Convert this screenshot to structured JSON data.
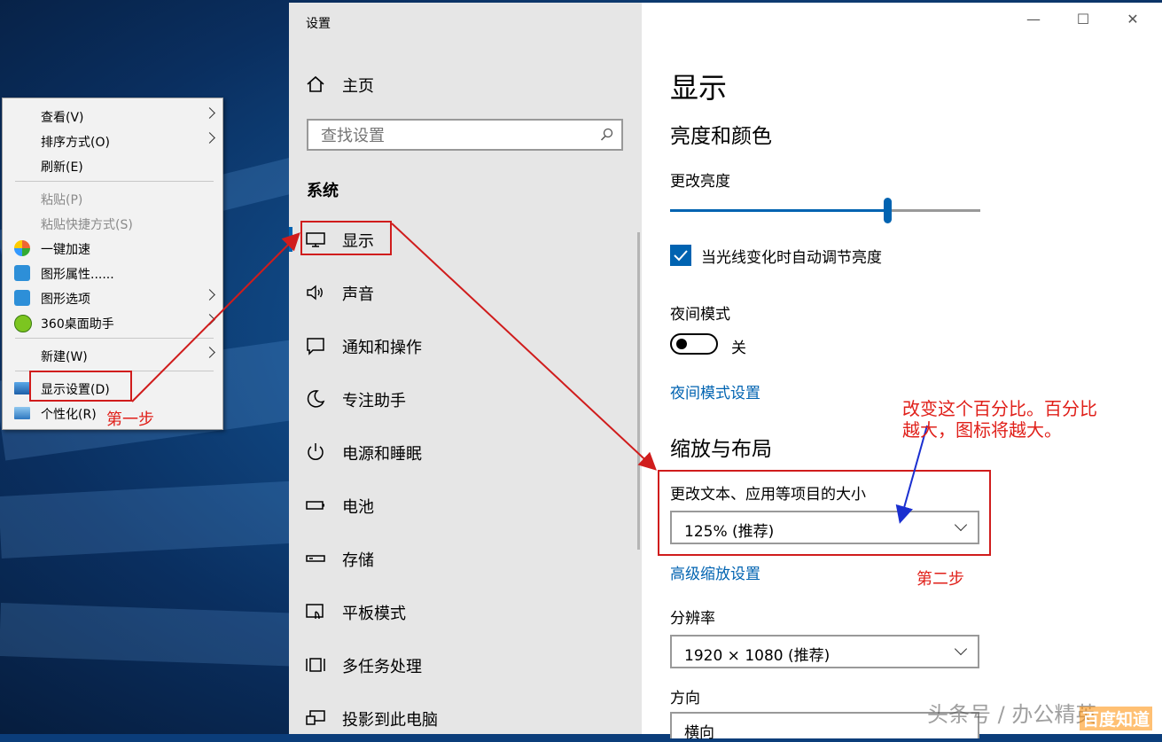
{
  "context_menu": {
    "items": [
      {
        "label": "查看(V)",
        "submenu": true
      },
      {
        "label": "排序方式(O)",
        "submenu": true
      },
      {
        "label": "刷新(E)"
      },
      {
        "label": "粘贴(P)",
        "disabled": true
      },
      {
        "label": "粘贴快捷方式(S)",
        "disabled": true
      },
      {
        "label": "一键加速",
        "icon": "speedup-icon"
      },
      {
        "label": "图形属性......",
        "icon": "graphics-properties-icon"
      },
      {
        "label": "图形选项",
        "icon": "graphics-options-icon",
        "submenu": true
      },
      {
        "label": "360桌面助手",
        "icon": "360-desktop-icon",
        "submenu": true
      },
      {
        "label": "新建(W)",
        "submenu": true
      },
      {
        "label": "显示设置(D)",
        "icon": "display-settings-icon"
      },
      {
        "label": "个性化(R)",
        "icon": "personalize-icon"
      }
    ]
  },
  "window": {
    "title": "设置",
    "controls": {
      "minimize": "—",
      "maximize": "☐",
      "close": "✕"
    }
  },
  "sidebar": {
    "home": "主页",
    "search_placeholder": "查找设置",
    "section": "系统",
    "items": [
      {
        "label": "显示",
        "icon": "monitor-icon",
        "selected": true
      },
      {
        "label": "声音",
        "icon": "speaker-icon"
      },
      {
        "label": "通知和操作",
        "icon": "notification-icon"
      },
      {
        "label": "专注助手",
        "icon": "moon-icon"
      },
      {
        "label": "电源和睡眠",
        "icon": "power-icon"
      },
      {
        "label": "电池",
        "icon": "battery-icon"
      },
      {
        "label": "存储",
        "icon": "storage-icon"
      },
      {
        "label": "平板模式",
        "icon": "tablet-mode-icon"
      },
      {
        "label": "多任务处理",
        "icon": "multitask-icon"
      },
      {
        "label": "投影到此电脑",
        "icon": "project-icon"
      }
    ]
  },
  "content": {
    "title": "显示",
    "brightness_heading": "亮度和颜色",
    "brightness_label": "更改亮度",
    "brightness_level": 0.7,
    "auto_brightness_label": "当光线变化时自动调节亮度",
    "auto_brightness_checked": true,
    "night_mode_label": "夜间模式",
    "night_mode_state": "关",
    "night_mode_link": "夜间模式设置",
    "scale_heading": "缩放与布局",
    "scale_label": "更改文本、应用等项目的大小",
    "scale_value": "125% (推荐)",
    "advanced_scale_link": "高级缩放设置",
    "resolution_label": "分辨率",
    "resolution_value": "1920 × 1080 (推荐)",
    "orientation_label": "方向",
    "orientation_value": "横向"
  },
  "annotations": {
    "step1": "第一步",
    "step2": "第二步",
    "note_line1": "改变这个百分比。百分比",
    "note_line2": "越大，图标将越大。",
    "color": "#e0201a"
  },
  "watermark": {
    "text": "头条号 / 办公精英",
    "logo": "百度知道"
  }
}
